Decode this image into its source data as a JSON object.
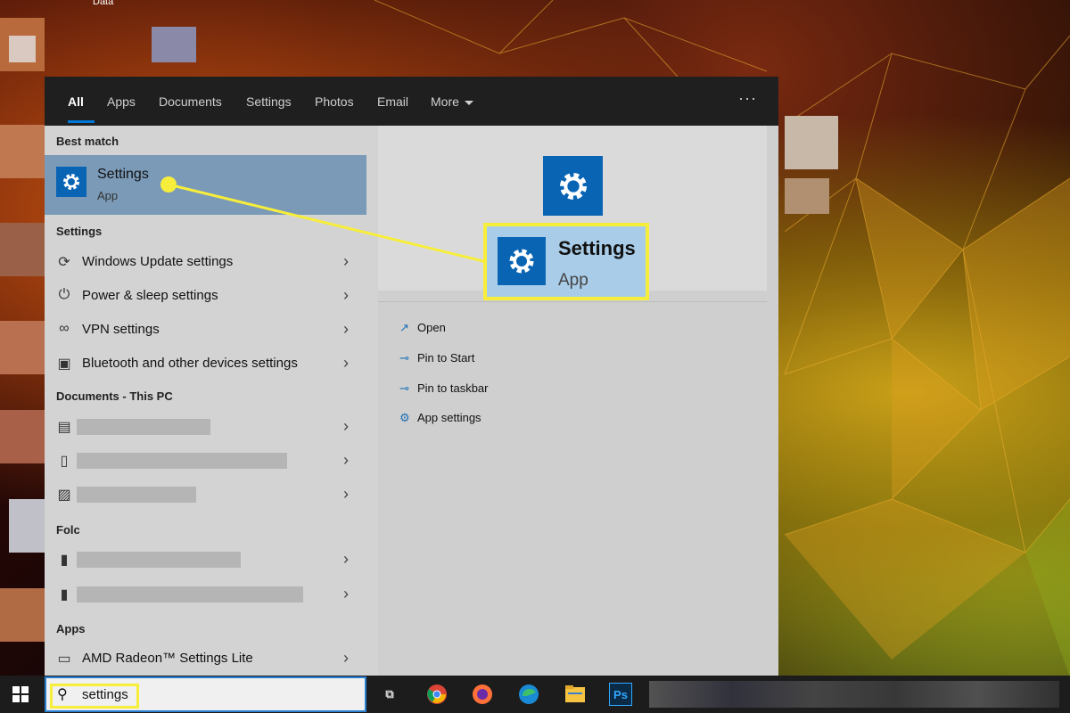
{
  "desktop": {
    "label": "Data"
  },
  "tabs": [
    {
      "label": "All"
    },
    {
      "label": "Apps"
    },
    {
      "label": "Documents"
    },
    {
      "label": "Settings"
    },
    {
      "label": "Photos"
    },
    {
      "label": "Email"
    },
    {
      "label": "More"
    }
  ],
  "topbar": {
    "more_options": "···"
  },
  "sections": {
    "best_match": "Best match",
    "settings": "Settings",
    "documents": "Documents - This PC",
    "folders": "Folc",
    "apps": "Apps"
  },
  "best_match": {
    "title": "Settings",
    "subtitle": "App",
    "icon": "gear-icon"
  },
  "settings_results": [
    {
      "label": "Windows Update settings",
      "icon": "sync-icon"
    },
    {
      "label": "Power & sleep settings",
      "icon": "power-icon"
    },
    {
      "label": "VPN settings",
      "icon": "vpn-icon"
    },
    {
      "label": "Bluetooth and other devices settings",
      "icon": "devices-icon"
    }
  ],
  "apps_results": [
    {
      "label": "AMD Radeon™ Settings Lite",
      "icon": "app-window-icon"
    }
  ],
  "preview": {
    "callout_title": "Settings",
    "callout_subtitle": "App",
    "actions": [
      {
        "label": "Open",
        "icon": "open-icon"
      },
      {
        "label": "Pin to Start",
        "icon": "pin-icon"
      },
      {
        "label": "Pin to taskbar",
        "icon": "pin-icon"
      },
      {
        "label": "App settings",
        "icon": "gear-icon"
      }
    ]
  },
  "search": {
    "value": "settings"
  },
  "taskbar": {
    "ps_label": "Ps"
  },
  "colors": {
    "accent": "#0078d7",
    "highlight": "#f7ee3b",
    "app_tile": "#0a64b4"
  }
}
